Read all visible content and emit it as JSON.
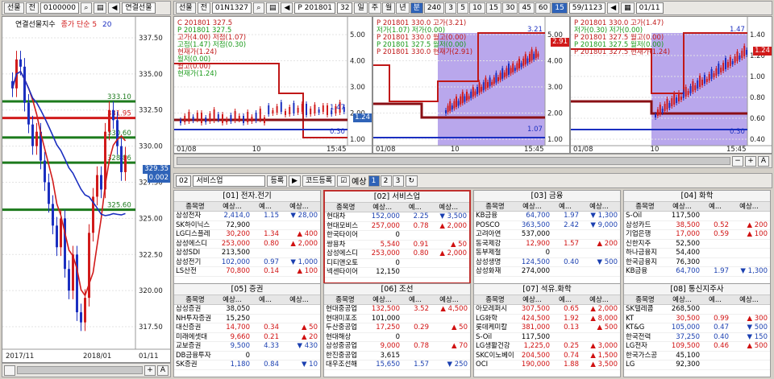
{
  "left": {
    "toolbar": {
      "mode": "선물",
      "jeon": "전",
      "code": "0100000",
      "combo": "연결선물"
    },
    "legend": {
      "title": "연결선물지수",
      "ind": "종가 단순 5",
      "period": "20"
    },
    "y_ticks": [
      "337.50",
      "335.00",
      "332.50",
      "330.00",
      "327.50",
      "325.00",
      "322.50",
      "320.00",
      "317.50"
    ],
    "levels": [
      {
        "label": "333.10",
        "value": 333.1,
        "color": "#1c7a1c"
      },
      {
        "label": "331.95",
        "value": 331.95,
        "color": "#d11b1b"
      },
      {
        "label": "330.60",
        "value": 330.6,
        "color": "#1c7a1c"
      },
      {
        "label": "328.86",
        "value": 328.86,
        "color": "#1c7a1c"
      },
      {
        "label": "325.60",
        "value": 325.6,
        "color": "#1c7a1c"
      }
    ],
    "price_tag": "329.35",
    "price_tag2": "0.002",
    "x_labels": [
      "2017/11",
      "2018/01",
      "01/11"
    ],
    "chart_data": {
      "type": "line",
      "title": "연결선물지수",
      "ylim": [
        316.5,
        338.5
      ],
      "series": [
        {
          "name": "종가 단순 5",
          "color": "#d11b1b"
        },
        {
          "name": "20",
          "color": "#1b2fc0"
        }
      ]
    }
  },
  "mid": {
    "toolbar": {
      "mode": "선물",
      "jeon": "전",
      "code": "01N1327",
      "opt": "P 201801",
      "num": "32",
      "btns": [
        "일",
        "주",
        "월",
        "년",
        "분",
        "240",
        "3",
        "5",
        "10",
        "15",
        "30",
        "45",
        "60",
        "15"
      ],
      "active": [
        "분",
        "15"
      ],
      "count": "59/1123",
      "date": "01/11"
    },
    "chart1": {
      "legend": [
        "C 201801 327.5",
        "P 201801 327.5",
        "고가(4.00) 저점(1.07)",
        "고점(1.47) 저점(0.30)",
        "현재가(1.24)",
        "월저(0.00)",
        "월고(0.00)",
        "현재가(1.24)"
      ],
      "y_ticks": [
        "5.00",
        "4.00",
        "3.00",
        "2.00",
        "1.00"
      ],
      "levels": [
        "1.47",
        "0.30"
      ],
      "price_tag": "1.24",
      "x_labels": [
        "01/08",
        "10",
        "15:45"
      ]
    },
    "chart2": {
      "legend": [
        "P 201801 330.0 고가(3.21)",
        "저가(1.07) 저가(0.00)",
        "P 201801 330.0 월고(0.00)",
        "P 201801 327.5 월저(0.00)",
        "P 201801 330.0 현재가(2.91)"
      ],
      "y_ticks": [
        "5.00",
        "4.00",
        "3.00",
        "2.00",
        "1.00"
      ],
      "levels": [
        "3.21",
        "1.07"
      ],
      "price_tag": "2.91",
      "x_labels": [
        "01/08",
        "10",
        "15:45"
      ]
    },
    "chart3": {
      "legend": [
        "P 201801 330.0 고가(1.47)",
        "저가(0.30) 저가(0.00)",
        "P 201801 327.5 월고(0.00)",
        "P 201801 327.5 월저(0.00)",
        "P 201801 327.5 현재가(1.24)"
      ],
      "y_ticks": [
        "1.40",
        "1.20",
        "1.00",
        "0.80",
        "0.60",
        "0.40"
      ],
      "levels": [
        "1.47",
        "0.30"
      ],
      "price_tag": "1.24",
      "x_labels": [
        "01/08",
        "10",
        "15:45"
      ]
    },
    "chart_data": {
      "type": "line",
      "series": [
        {
          "name": "C 201801 327.5"
        },
        {
          "name": "P 201801 327.5"
        },
        {
          "name": "P 201801 330.0"
        }
      ]
    }
  },
  "sector": {
    "toolbar": {
      "num": "02",
      "name": "서비스업",
      "reg": "등록",
      "code_reg": "코드등록",
      "pre": "예상",
      "pages": [
        "1",
        "2",
        "3"
      ]
    },
    "headers": [
      "종목명",
      "예상...",
      "예...",
      "예상..."
    ],
    "panels": [
      {
        "title": "[01] 전자.전기",
        "rows": [
          {
            "n": "삼성전자",
            "p": "2,414,0",
            "r": "1.15",
            "c": "▼ 28,00",
            "d": "dn"
          },
          {
            "n": "SK하이닉스",
            "p": "72,900",
            "r": "",
            "c": "",
            "d": "nc"
          },
          {
            "n": "LG디스플레",
            "p": "30,200",
            "r": "1.34",
            "c": "▲ 400",
            "d": "up"
          },
          {
            "n": "삼성에스디",
            "p": "253,000",
            "r": "0.80",
            "c": "▲ 2,000",
            "d": "up"
          },
          {
            "n": "삼성SDI",
            "p": "213,500",
            "r": "",
            "c": "",
            "d": "nc"
          },
          {
            "n": "삼성전기",
            "p": "102,000",
            "r": "0.97",
            "c": "▼ 1,000",
            "d": "dn"
          },
          {
            "n": "LS산전",
            "p": "70,800",
            "r": "0.14",
            "c": "▲ 100",
            "d": "up"
          }
        ]
      },
      {
        "title": "[02] 서비스업",
        "rows": [
          {
            "n": "현대차",
            "p": "152,000",
            "r": "2.25",
            "c": "▼ 3,500",
            "d": "dn"
          },
          {
            "n": "현대모비스",
            "p": "257,000",
            "r": "0.78",
            "c": "▲ 2,000",
            "d": "up"
          },
          {
            "n": "한국타이어",
            "p": "0",
            "r": "",
            "c": "",
            "d": "nc"
          },
          {
            "n": "쌍용차",
            "p": "5,540",
            "r": "0.91",
            "c": "▲ 50",
            "d": "up"
          },
          {
            "n": "삼성에스디",
            "p": "253,000",
            "r": "0.80",
            "c": "▲ 2,000",
            "d": "up"
          },
          {
            "n": "디티앤오토",
            "p": "0",
            "r": "",
            "c": "",
            "d": "nc"
          },
          {
            "n": "넥센타이어",
            "p": "12,150",
            "r": "",
            "c": "",
            "d": "nc"
          }
        ]
      },
      {
        "title": "[03] 금융",
        "rows": [
          {
            "n": "KB금융",
            "p": "64,700",
            "r": "1.97",
            "c": "▼ 1,300",
            "d": "dn"
          },
          {
            "n": "POSCO",
            "p": "363,500",
            "r": "2.42",
            "c": "▼ 9,000",
            "d": "dn"
          },
          {
            "n": "고려아연",
            "p": "537,000",
            "r": "",
            "c": "",
            "d": "nc"
          },
          {
            "n": "동국제강",
            "p": "12,900",
            "r": "1.57",
            "c": "▲ 200",
            "d": "up"
          },
          {
            "n": "동부제철",
            "p": "0",
            "r": "",
            "c": "",
            "d": "nc"
          },
          {
            "n": "삼성생명",
            "p": "124,500",
            "r": "0.40",
            "c": "▼ 500",
            "d": "dn"
          },
          {
            "n": "삼성화재",
            "p": "274,000",
            "r": "",
            "c": "",
            "d": "nc"
          }
        ]
      },
      {
        "title": "[04] 화학",
        "rows": [
          {
            "n": "S-Oil",
            "p": "117,500",
            "r": "",
            "c": "",
            "d": "nc"
          },
          {
            "n": "삼성카드",
            "p": "38,500",
            "r": "0.52",
            "c": "▲ 200",
            "d": "up"
          },
          {
            "n": "기업은행",
            "p": "17,000",
            "r": "0.59",
            "c": "▲ 100",
            "d": "up"
          },
          {
            "n": "신한지주",
            "p": "52,500",
            "r": "",
            "c": "",
            "d": "nc"
          },
          {
            "n": "하나금융지",
            "p": "54,400",
            "r": "",
            "c": "",
            "d": "nc"
          },
          {
            "n": "한국금융지",
            "p": "76,300",
            "r": "",
            "c": "",
            "d": "nc"
          },
          {
            "n": "KB금융",
            "p": "64,700",
            "r": "1.97",
            "c": "▼ 1,300",
            "d": "dn"
          }
        ]
      },
      {
        "title": "[05] 증권",
        "rows": [
          {
            "n": "삼성증권",
            "p": "38,050",
            "r": "",
            "c": "",
            "d": "nc"
          },
          {
            "n": "NH투자증권",
            "p": "15,250",
            "r": "",
            "c": "",
            "d": "nc"
          },
          {
            "n": "대신증권",
            "p": "14,700",
            "r": "0.34",
            "c": "▲ 50",
            "d": "up"
          },
          {
            "n": "미래에셋대",
            "p": "9,660",
            "r": "0.21",
            "c": "▲ 20",
            "d": "up"
          },
          {
            "n": "교보증권",
            "p": "9,500",
            "r": "4.33",
            "c": "▼ 430",
            "d": "dn"
          },
          {
            "n": "DB금융투자",
            "p": "0",
            "r": "",
            "c": "",
            "d": "nc"
          },
          {
            "n": "SK증권",
            "p": "1,180",
            "r": "0.84",
            "c": "▼ 10",
            "d": "dn"
          }
        ]
      },
      {
        "title": "[06] 조선",
        "rows": [
          {
            "n": "현대중공업",
            "p": "132,500",
            "r": "3.52",
            "c": "▲ 4,500",
            "d": "up"
          },
          {
            "n": "현대미포조",
            "p": "101,000",
            "r": "",
            "c": "",
            "d": "nc"
          },
          {
            "n": "두산중공업",
            "p": "17,250",
            "r": "0.29",
            "c": "▲ 50",
            "d": "up"
          },
          {
            "n": "현대해상",
            "p": "0",
            "r": "",
            "c": "",
            "d": "nc"
          },
          {
            "n": "삼성중공업",
            "p": "9,000",
            "r": "0.78",
            "c": "▲ 70",
            "d": "up"
          },
          {
            "n": "한진중공업",
            "p": "3,615",
            "r": "",
            "c": "",
            "d": "nc"
          },
          {
            "n": "대우조선해",
            "p": "15,650",
            "r": "1.57",
            "c": "▼ 250",
            "d": "dn"
          }
        ]
      },
      {
        "title": "[07] 석유.화학",
        "rows": [
          {
            "n": "아모레퍼시",
            "p": "307,500",
            "r": "0.65",
            "c": "▲ 2,000",
            "d": "up"
          },
          {
            "n": "LG화학",
            "p": "424,500",
            "r": "1.92",
            "c": "▲ 8,000",
            "d": "up"
          },
          {
            "n": "롯데케미칼",
            "p": "381,000",
            "r": "0.13",
            "c": "▲ 500",
            "d": "up"
          },
          {
            "n": "S-Oil",
            "p": "117,500",
            "r": "",
            "c": "",
            "d": "nc"
          },
          {
            "n": "LG생활건강",
            "p": "1,225,0",
            "r": "0.25",
            "c": "▲ 3,000",
            "d": "up"
          },
          {
            "n": "SKC이노베이",
            "p": "204,500",
            "r": "0.74",
            "c": "▲ 1,500",
            "d": "up"
          },
          {
            "n": "OCI",
            "p": "190,000",
            "r": "1.88",
            "c": "▲ 3,500",
            "d": "up"
          }
        ]
      },
      {
        "title": "[08] 통신지주사",
        "rows": [
          {
            "n": "SK텔레콤",
            "p": "268,500",
            "r": "",
            "c": "",
            "d": "nc"
          },
          {
            "n": "KT",
            "p": "30,500",
            "r": "0.99",
            "c": "▲ 300",
            "d": "up"
          },
          {
            "n": "KT&G",
            "p": "105,000",
            "r": "0.47",
            "c": "▼ 500",
            "d": "dn"
          },
          {
            "n": "한국전력",
            "p": "37,250",
            "r": "0.40",
            "c": "▼ 150",
            "d": "dn"
          },
          {
            "n": "LG전자",
            "p": "109,500",
            "r": "0.46",
            "c": "▲ 500",
            "d": "up"
          },
          {
            "n": "한국가스공",
            "p": "45,100",
            "r": "",
            "c": "",
            "d": "nc"
          },
          {
            "n": "LG",
            "p": "92,300",
            "r": "",
            "c": "",
            "d": "nc"
          }
        ]
      }
    ]
  }
}
